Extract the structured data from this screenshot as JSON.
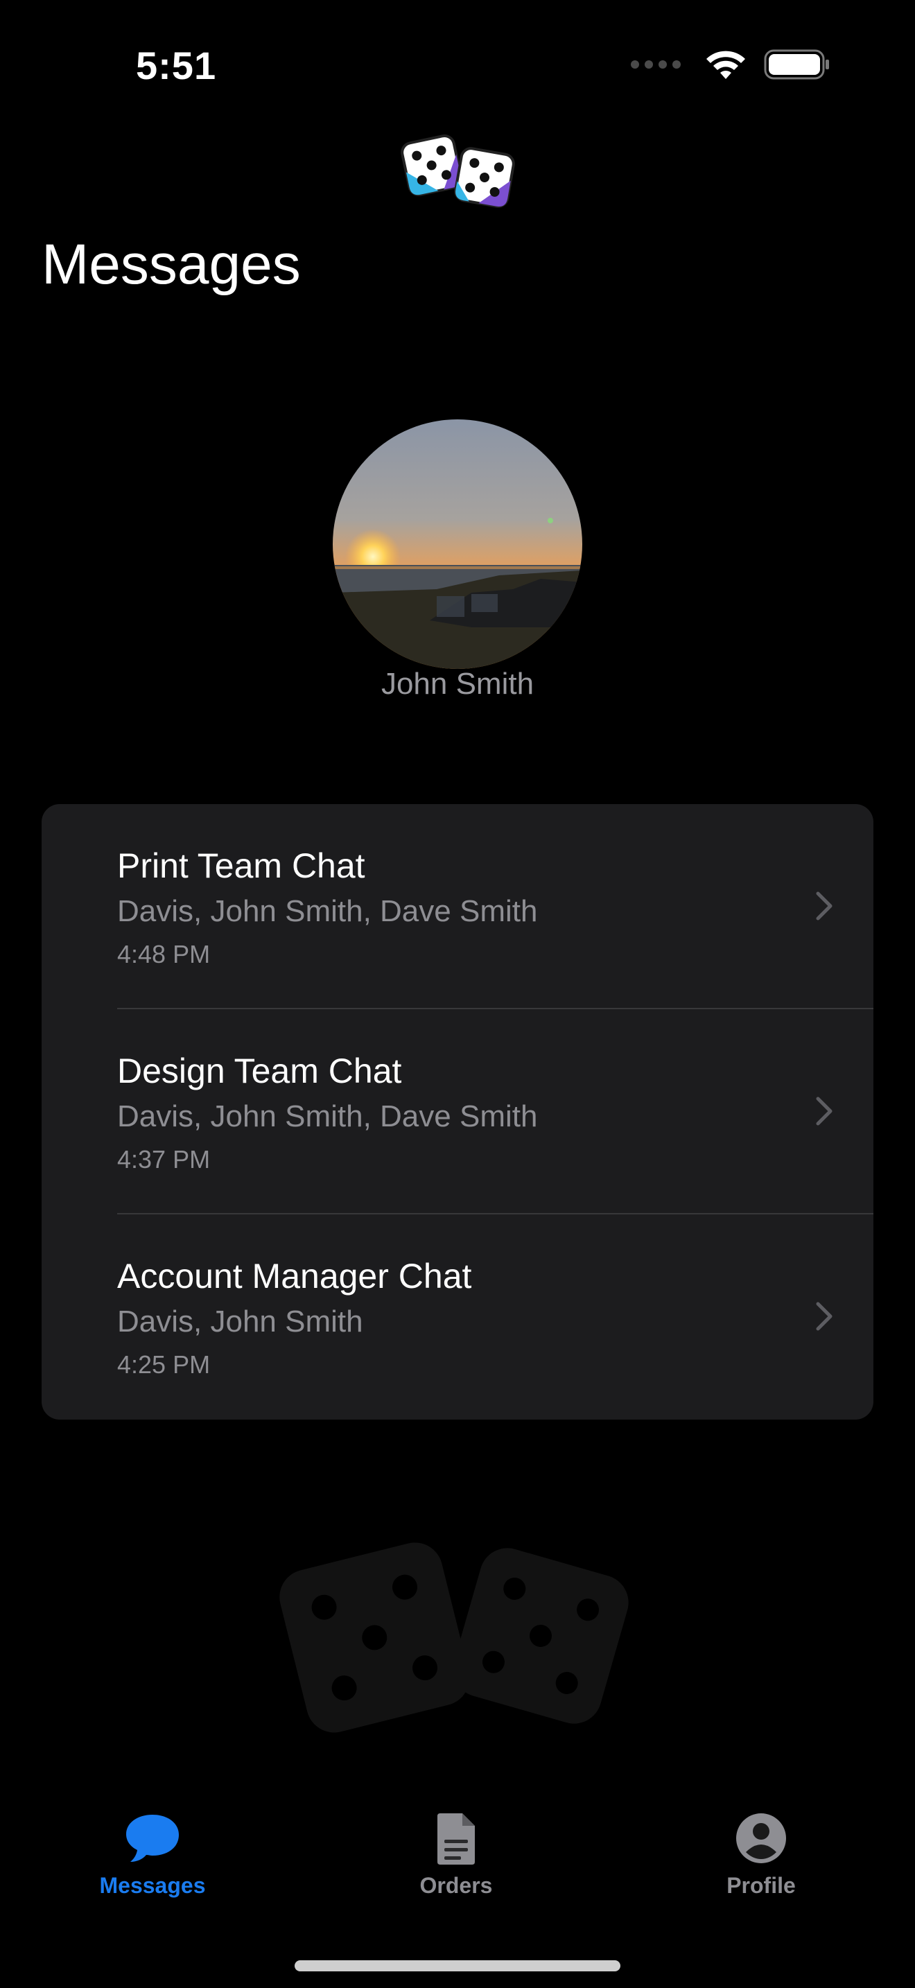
{
  "status_bar": {
    "time": "5:51"
  },
  "header": {
    "title": "Messages"
  },
  "profile": {
    "name": "John Smith"
  },
  "chats": [
    {
      "title": "Print Team Chat",
      "members": "Davis, John Smith, Dave Smith",
      "time": "4:48 PM"
    },
    {
      "title": "Design Team Chat",
      "members": "Davis, John Smith, Dave Smith",
      "time": "4:37 PM"
    },
    {
      "title": "Account Manager Chat",
      "members": "Davis, John Smith",
      "time": "4:25 PM"
    }
  ],
  "tab_bar": {
    "tabs": [
      {
        "label": "Messages",
        "icon": "chat-bubble-icon",
        "active": true
      },
      {
        "label": "Orders",
        "icon": "document-icon",
        "active": false
      },
      {
        "label": "Profile",
        "icon": "person-circle-icon",
        "active": false
      }
    ]
  },
  "colors": {
    "accent": "#1a7cf0",
    "inactive_tab": "#8e8e93",
    "card": "#1c1c1e",
    "background": "#000000"
  }
}
